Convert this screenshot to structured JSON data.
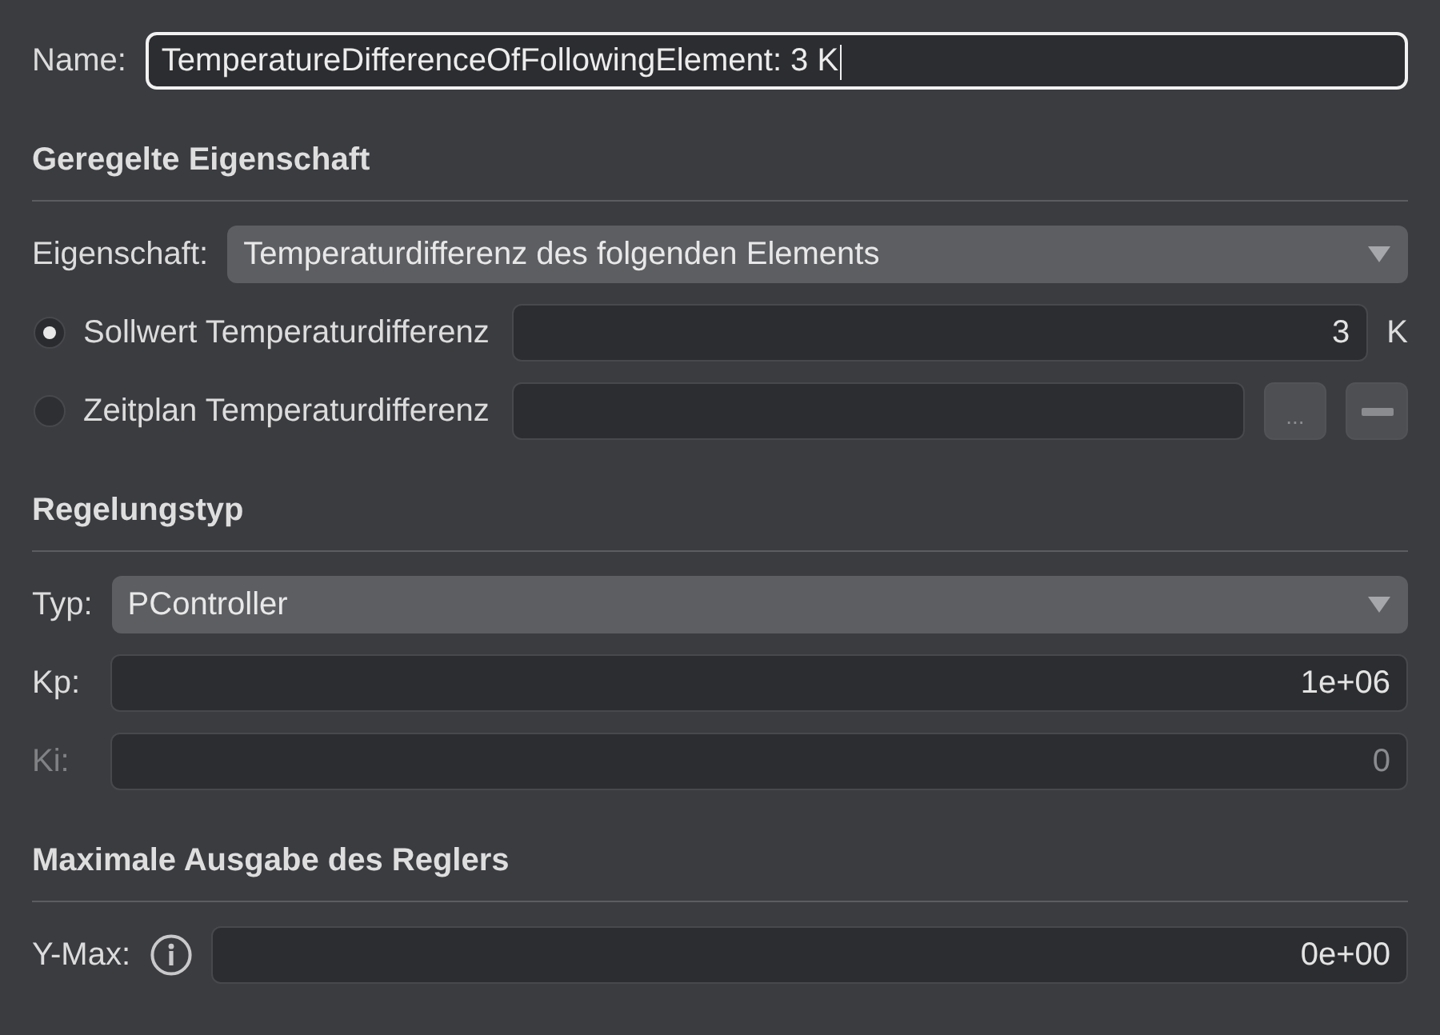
{
  "name_field": {
    "label": "Name:",
    "value": "TemperatureDifferenceOfFollowingElement: 3 K",
    "focused": true
  },
  "sections": [
    {
      "title": "Geregelte Eigenschaft",
      "rows": [
        {
          "kind": "combo",
          "label": "Eigenschaft:",
          "value": "Temperaturdifferenz des folgenden Elements"
        },
        {
          "kind": "radio",
          "label": "Sollwert Temperaturdifferenz",
          "selected": true,
          "value": "3",
          "unit": "K"
        },
        {
          "kind": "radio",
          "label": "Zeitplan Temperaturdifferenz",
          "selected": false,
          "buttons": [
            {
              "kind": "browse",
              "label": "...",
              "disabled": true
            },
            {
              "kind": "remove",
              "disabled": true
            }
          ]
        }
      ]
    },
    {
      "title": "Regelungstyp",
      "rows": [
        {
          "kind": "combo",
          "label": "Typ:",
          "value": "PController"
        },
        {
          "kind": "number",
          "label": "Kp:",
          "value": "1e+06",
          "disabled": false
        },
        {
          "kind": "number",
          "label": "Ki:",
          "value": "0",
          "disabled": true
        }
      ]
    },
    {
      "title": "Maximale Ausgabe des Reglers",
      "rows": [
        {
          "kind": "number",
          "label": "Y-Max:",
          "value": "0e+00",
          "disabled": false,
          "info": true
        }
      ]
    }
  ]
}
